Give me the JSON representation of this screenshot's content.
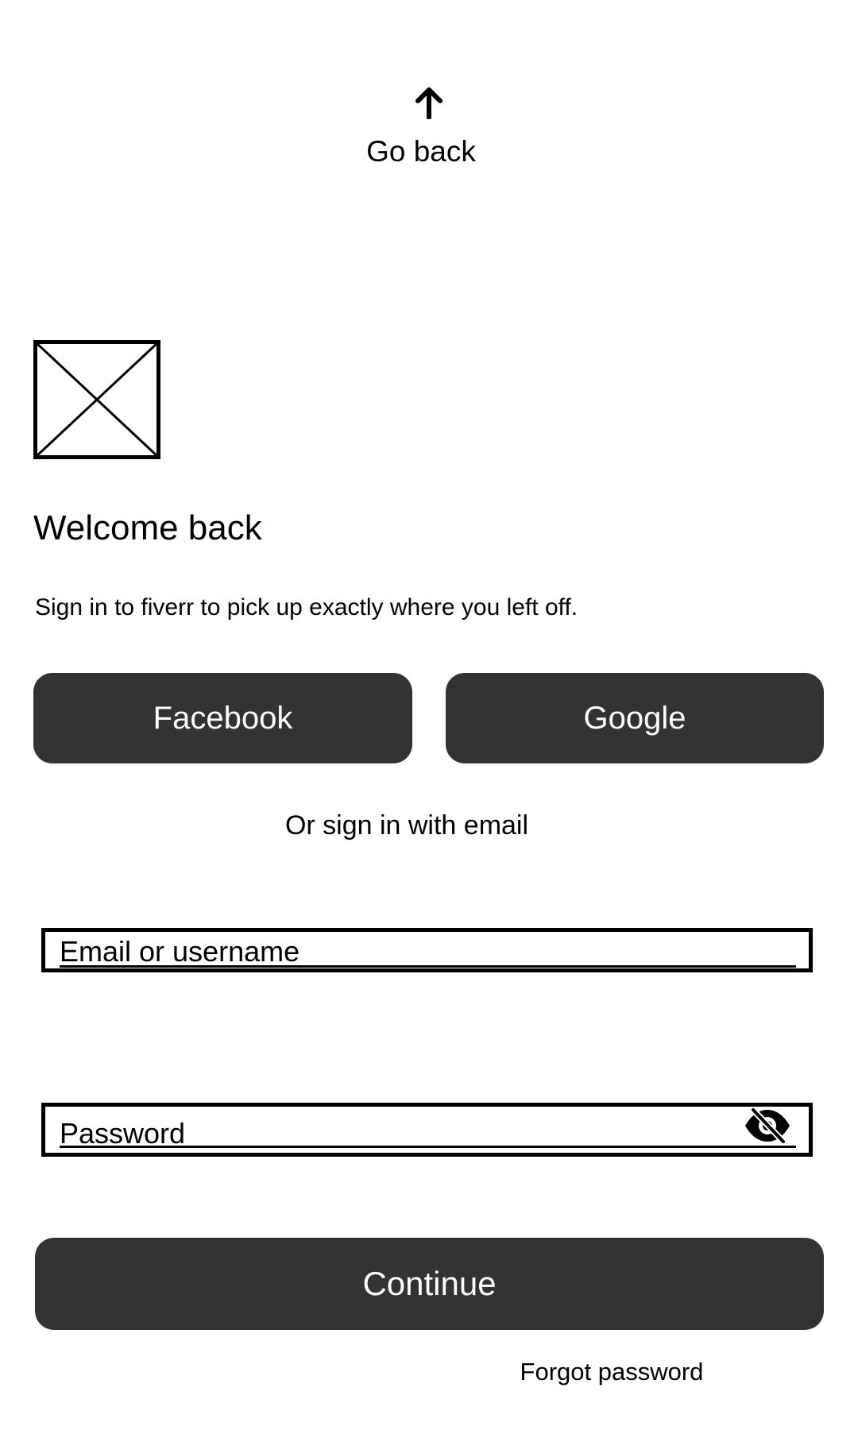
{
  "header": {
    "back_label": "Go back",
    "back_icon": "arrow-up-icon"
  },
  "hero": {
    "logo_icon": "image-placeholder-icon",
    "title": "Welcome back",
    "subtitle": "Sign in to fiverr to pick up exactly where you left off."
  },
  "social": {
    "facebook_label": "Facebook",
    "google_label": "Google"
  },
  "divider": {
    "text": "Or sign in with email"
  },
  "form": {
    "email_label": "Email or username",
    "password_label": "Password",
    "password_visibility_icon": "eye-slash-icon",
    "continue_label": "Continue",
    "forgot_label": "Forgot password"
  },
  "colors": {
    "button_background": "#333333",
    "button_text": "#ffffff",
    "text": "#000000",
    "background": "#ffffff"
  }
}
